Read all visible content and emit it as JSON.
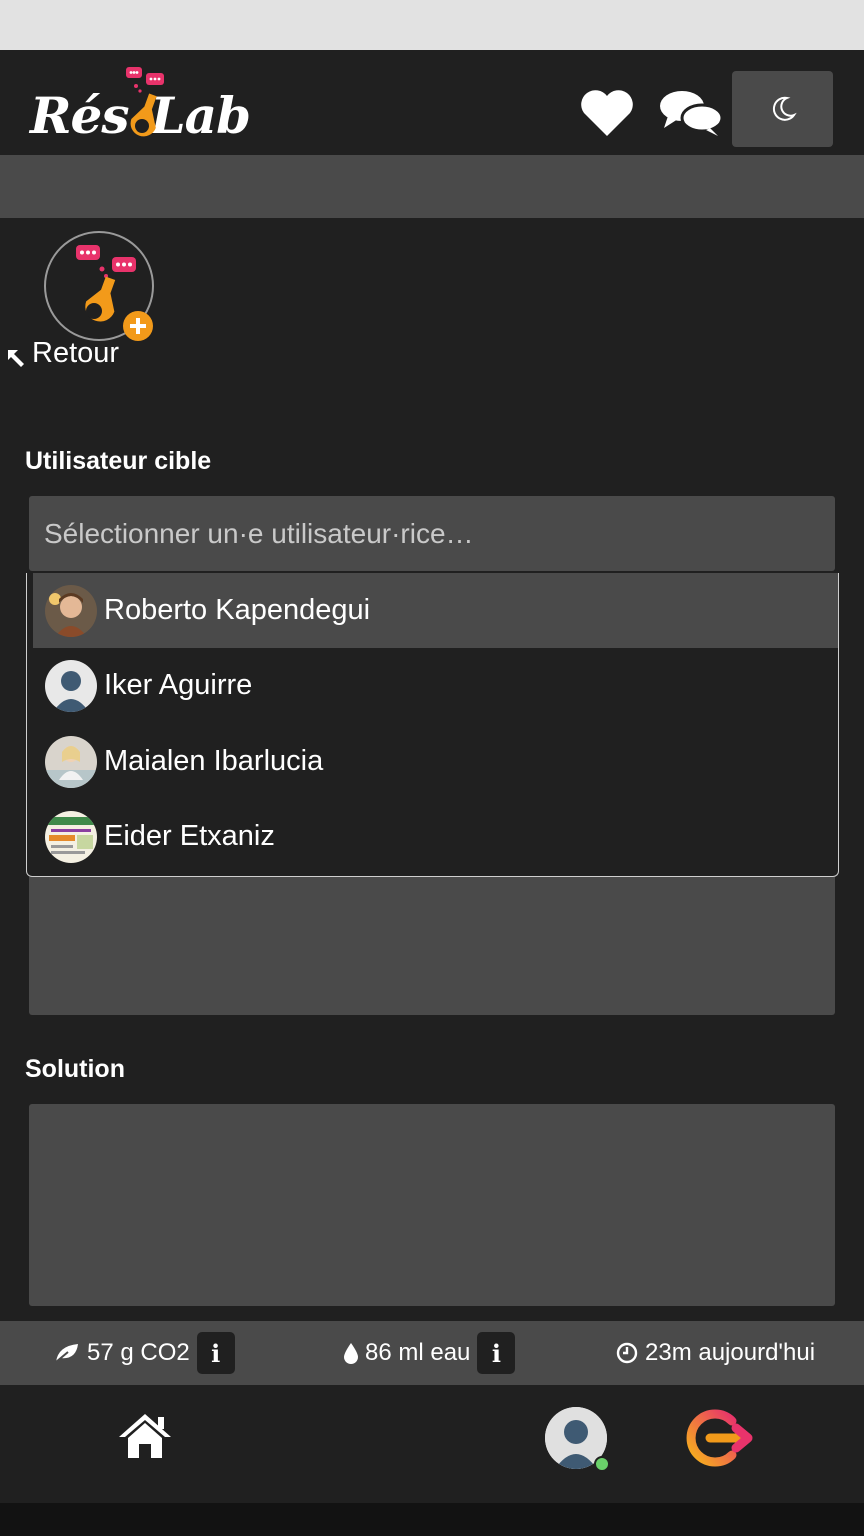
{
  "app": {
    "name": "RésoLab",
    "logo_left": "Rés",
    "logo_right": "Lab"
  },
  "header": {
    "favorites_icon": "heart-icon",
    "messages_icon": "chat-bubbles-icon",
    "theme_icon": "moon-icon"
  },
  "nav": {
    "back_label": "Retour",
    "back_icon": "arrow-left-icon"
  },
  "form": {
    "target_user_label": "Utilisateur cible",
    "target_user_placeholder": "Sélectionner un·e utilisateur·rice…",
    "solution_label": "Solution",
    "users": [
      {
        "name": "Roberto Kapendegui",
        "highlighted": true
      },
      {
        "name": "Iker Aguirre",
        "highlighted": false
      },
      {
        "name": "Maialen Ibarlucia",
        "highlighted": false
      },
      {
        "name": "Eider Etxaniz",
        "highlighted": false
      }
    ]
  },
  "stats": {
    "co2": "57 g CO2",
    "water": "86 ml eau",
    "time": "23m aujourd'hui",
    "info_label": "i"
  },
  "colors": {
    "background": "#202020",
    "panel": "#4a4a4a",
    "accent_orange": "#f29a1a",
    "accent_pink": "#e8336b",
    "online": "#6ad06a"
  }
}
